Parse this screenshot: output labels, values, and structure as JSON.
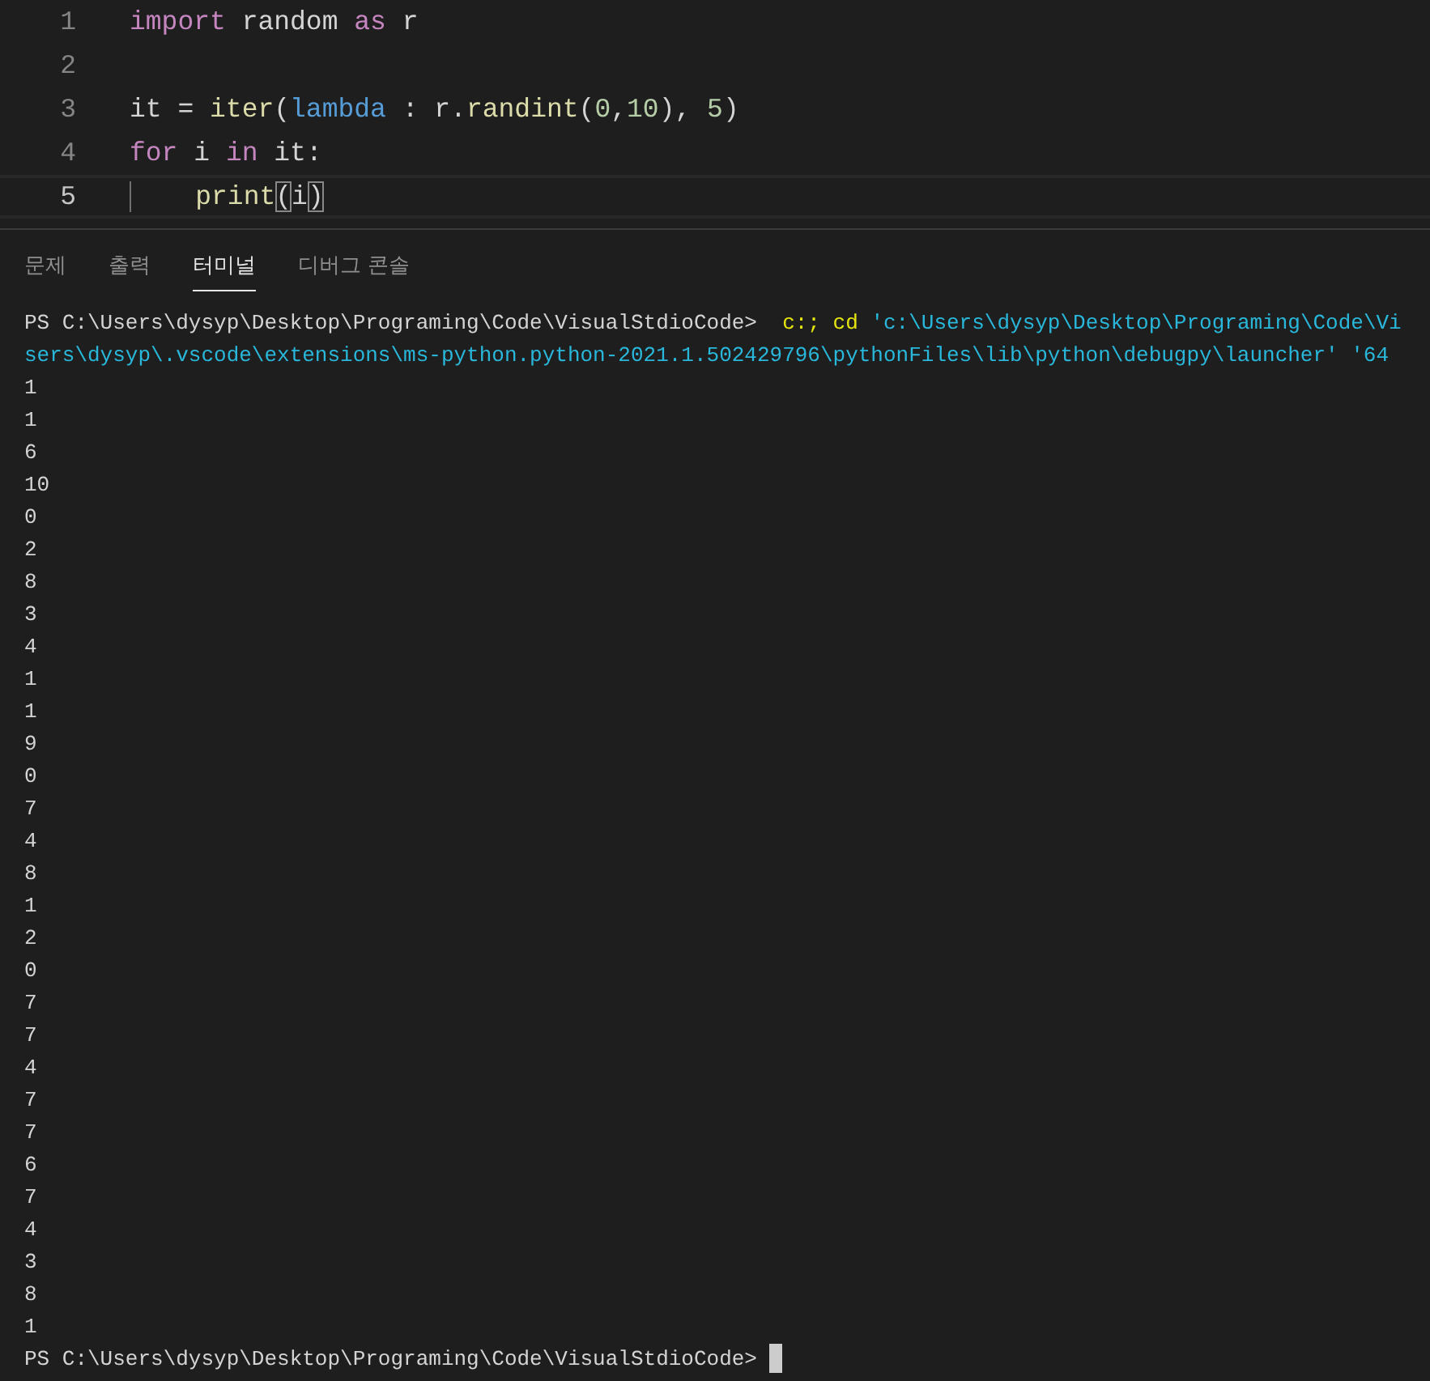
{
  "editor": {
    "lines": [
      {
        "number": "1",
        "active": false,
        "tokens": [
          {
            "kind": "keyword",
            "text": "import"
          },
          {
            "kind": "plain",
            "text": " random "
          },
          {
            "kind": "keyword",
            "text": "as"
          },
          {
            "kind": "plain",
            "text": " r"
          }
        ]
      },
      {
        "number": "2",
        "active": false
      },
      {
        "number": "3",
        "active": false,
        "tokens": [
          {
            "kind": "plain",
            "text": "it = "
          },
          {
            "kind": "function",
            "text": "iter"
          },
          {
            "kind": "plain",
            "text": "("
          },
          {
            "kind": "storage",
            "text": "lambda"
          },
          {
            "kind": "plain",
            "text": " : r."
          },
          {
            "kind": "function",
            "text": "randint"
          },
          {
            "kind": "plain",
            "text": "("
          },
          {
            "kind": "number",
            "text": "0"
          },
          {
            "kind": "plain",
            "text": ","
          },
          {
            "kind": "number",
            "text": "10"
          },
          {
            "kind": "plain",
            "text": "), "
          },
          {
            "kind": "number",
            "text": "5"
          },
          {
            "kind": "plain",
            "text": ")"
          }
        ]
      },
      {
        "number": "4",
        "active": false,
        "tokens": [
          {
            "kind": "keyword",
            "text": "for"
          },
          {
            "kind": "plain",
            "text": " i "
          },
          {
            "kind": "keyword",
            "text": "in"
          },
          {
            "kind": "plain",
            "text": " it:"
          }
        ]
      },
      {
        "number": "5",
        "active": true,
        "indent_guide": true,
        "tokens": [
          {
            "kind": "function",
            "text": "print"
          },
          {
            "kind": "bracket",
            "text": "("
          },
          {
            "kind": "plain",
            "text": "i"
          },
          {
            "kind": "bracket",
            "text": ")"
          }
        ]
      }
    ]
  },
  "panel": {
    "tabs": [
      {
        "label": "문제",
        "selected": false
      },
      {
        "label": "출력",
        "selected": false
      },
      {
        "label": "터미널",
        "selected": true
      },
      {
        "label": "디버그 콘솔",
        "selected": false
      }
    ]
  },
  "terminal": {
    "lines": [
      [
        {
          "kind": "plain",
          "text": "PS C:\\Users\\dysyp\\Desktop\\Programing\\Code\\VisualStdioCode> "
        },
        {
          "kind": "command",
          "text": " c:; cd "
        },
        {
          "kind": "string",
          "text": "'c:\\Users\\dysyp\\Desktop\\Programing\\Code\\Vi"
        }
      ],
      [
        {
          "kind": "string",
          "text": "sers\\dysyp\\.vscode\\extensions\\ms-python.python-2021.1.502429796\\pythonFiles\\lib\\python\\debugpy\\launcher' '64"
        }
      ],
      [
        {
          "kind": "plain",
          "text": "1"
        }
      ],
      [
        {
          "kind": "plain",
          "text": "1"
        }
      ],
      [
        {
          "kind": "plain",
          "text": "6"
        }
      ],
      [
        {
          "kind": "plain",
          "text": "10"
        }
      ],
      [
        {
          "kind": "plain",
          "text": "0"
        }
      ],
      [
        {
          "kind": "plain",
          "text": "2"
        }
      ],
      [
        {
          "kind": "plain",
          "text": "8"
        }
      ],
      [
        {
          "kind": "plain",
          "text": "3"
        }
      ],
      [
        {
          "kind": "plain",
          "text": "4"
        }
      ],
      [
        {
          "kind": "plain",
          "text": "1"
        }
      ],
      [
        {
          "kind": "plain",
          "text": "1"
        }
      ],
      [
        {
          "kind": "plain",
          "text": "9"
        }
      ],
      [
        {
          "kind": "plain",
          "text": "0"
        }
      ],
      [
        {
          "kind": "plain",
          "text": "7"
        }
      ],
      [
        {
          "kind": "plain",
          "text": "4"
        }
      ],
      [
        {
          "kind": "plain",
          "text": "8"
        }
      ],
      [
        {
          "kind": "plain",
          "text": "1"
        }
      ],
      [
        {
          "kind": "plain",
          "text": "2"
        }
      ],
      [
        {
          "kind": "plain",
          "text": "0"
        }
      ],
      [
        {
          "kind": "plain",
          "text": "7"
        }
      ],
      [
        {
          "kind": "plain",
          "text": "7"
        }
      ],
      [
        {
          "kind": "plain",
          "text": "4"
        }
      ],
      [
        {
          "kind": "plain",
          "text": "7"
        }
      ],
      [
        {
          "kind": "plain",
          "text": "7"
        }
      ],
      [
        {
          "kind": "plain",
          "text": "6"
        }
      ],
      [
        {
          "kind": "plain",
          "text": "7"
        }
      ],
      [
        {
          "kind": "plain",
          "text": "4"
        }
      ],
      [
        {
          "kind": "plain",
          "text": "3"
        }
      ],
      [
        {
          "kind": "plain",
          "text": "8"
        }
      ],
      [
        {
          "kind": "plain",
          "text": "1"
        }
      ],
      [
        {
          "kind": "plain",
          "text": "PS C:\\Users\\dysyp\\Desktop\\Programing\\Code\\VisualStdioCode> "
        }
      ]
    ],
    "cursor": true
  }
}
